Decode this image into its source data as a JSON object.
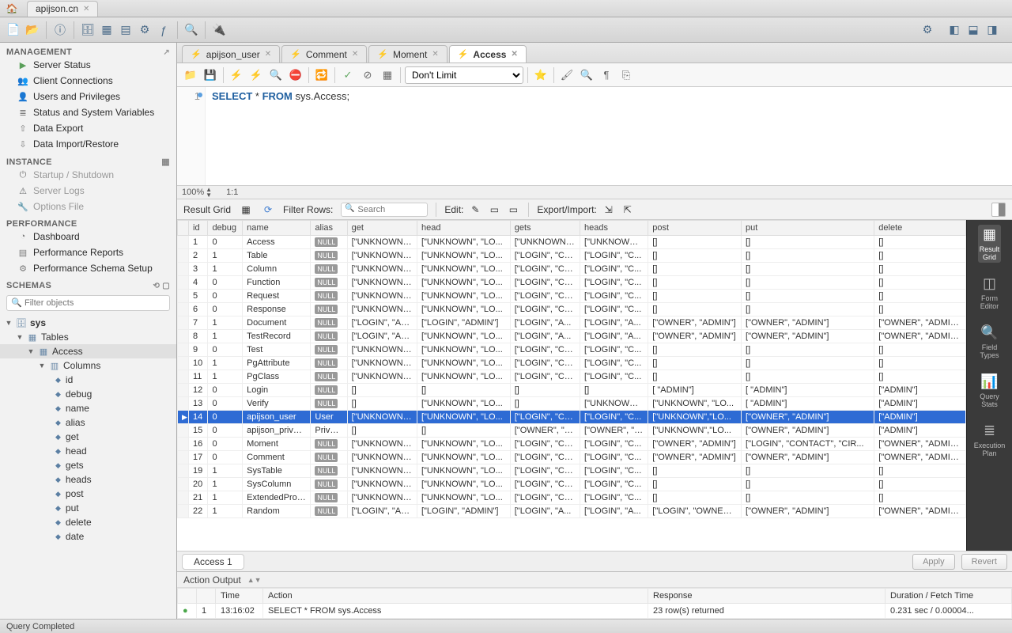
{
  "topTab": {
    "label": "apijson.cn"
  },
  "sidebar": {
    "management": {
      "title": "MANAGEMENT",
      "items": [
        {
          "label": "Server Status",
          "ic": "▶",
          "cls": "play"
        },
        {
          "label": "Client Connections",
          "ic": "👥"
        },
        {
          "label": "Users and Privileges",
          "ic": "👤"
        },
        {
          "label": "Status and System Variables",
          "ic": "≣"
        },
        {
          "label": "Data Export",
          "ic": "⇧"
        },
        {
          "label": "Data Import/Restore",
          "ic": "⇩"
        }
      ]
    },
    "instance": {
      "title": "INSTANCE",
      "items": [
        {
          "label": "Startup / Shutdown",
          "ic": "⏻",
          "dim": true
        },
        {
          "label": "Server Logs",
          "ic": "⚠",
          "cls": "warn",
          "dim": true
        },
        {
          "label": "Options File",
          "ic": "🔧",
          "dim": true
        }
      ]
    },
    "performance": {
      "title": "PERFORMANCE",
      "items": [
        {
          "label": "Dashboard",
          "ic": "◔"
        },
        {
          "label": "Performance Reports",
          "ic": "▤"
        },
        {
          "label": "Performance Schema Setup",
          "ic": "⚙"
        }
      ]
    },
    "schemas": {
      "title": "SCHEMAS",
      "filterPlaceholder": "Filter objects"
    },
    "tree": {
      "db": "sys",
      "tables": "Tables",
      "table": "Access",
      "columns": "Columns",
      "cols": [
        "id",
        "debug",
        "name",
        "alias",
        "get",
        "head",
        "gets",
        "heads",
        "post",
        "put",
        "delete",
        "date"
      ]
    }
  },
  "fileTabs": [
    {
      "label": "apijson_user",
      "active": false
    },
    {
      "label": "Comment",
      "active": false
    },
    {
      "label": "Moment",
      "active": false
    },
    {
      "label": "Access",
      "active": true
    }
  ],
  "sqlLimit": "Don't Limit",
  "query": "SELECT * FROM sys.Access;",
  "queryKw1": "SELECT",
  "queryStar": " * ",
  "queryKw2": "FROM",
  "queryRest": " sys.Access;",
  "zoom": "100%",
  "pos": "1:1",
  "resultBar": {
    "grid": "Result Grid",
    "filter": "Filter Rows:",
    "searchPlaceholder": "Search",
    "edit": "Edit:",
    "export": "Export/Import:"
  },
  "gridColumns": [
    "",
    "id",
    "debug",
    "name",
    "alias",
    "get",
    "head",
    "gets",
    "heads",
    "post",
    "put",
    "delete"
  ],
  "gridRows": [
    {
      "id": "1",
      "debug": "0",
      "name": "Access",
      "alias": null,
      "get": "[\"UNKNOWN\"...",
      "head": "[\"UNKNOWN\", \"LO...",
      "gets": "[\"UNKNOWN\",...",
      "heads": "[\"UNKNOWN\"...",
      "post": "[]",
      "put": "[]",
      "delete": "[]"
    },
    {
      "id": "2",
      "debug": "1",
      "name": "Table",
      "alias": null,
      "get": "[\"UNKNOWN\"...",
      "head": "[\"UNKNOWN\", \"LO...",
      "gets": "[\"LOGIN\", \"CO...",
      "heads": "[\"LOGIN\", \"C...",
      "post": "[]",
      "put": "[]",
      "delete": "[]"
    },
    {
      "id": "3",
      "debug": "1",
      "name": "Column",
      "alias": null,
      "get": "[\"UNKNOWN\"...",
      "head": "[\"UNKNOWN\", \"LO...",
      "gets": "[\"LOGIN\", \"CO...",
      "heads": "[\"LOGIN\", \"C...",
      "post": "[]",
      "put": "[]",
      "delete": "[]"
    },
    {
      "id": "4",
      "debug": "0",
      "name": "Function",
      "alias": null,
      "get": "[\"UNKNOWN\"...",
      "head": "[\"UNKNOWN\", \"LO...",
      "gets": "[\"LOGIN\", \"CO...",
      "heads": "[\"LOGIN\", \"C...",
      "post": "[]",
      "put": "[]",
      "delete": "[]"
    },
    {
      "id": "5",
      "debug": "0",
      "name": "Request",
      "alias": null,
      "get": "[\"UNKNOWN\"...",
      "head": "[\"UNKNOWN\", \"LO...",
      "gets": "[\"LOGIN\", \"CO...",
      "heads": "[\"LOGIN\", \"C...",
      "post": "[]",
      "put": "[]",
      "delete": "[]"
    },
    {
      "id": "6",
      "debug": "0",
      "name": "Response",
      "alias": null,
      "get": "[\"UNKNOWN\"...",
      "head": "[\"UNKNOWN\", \"LO...",
      "gets": "[\"LOGIN\", \"CO...",
      "heads": "[\"LOGIN\", \"C...",
      "post": "[]",
      "put": "[]",
      "delete": "[]"
    },
    {
      "id": "7",
      "debug": "1",
      "name": "Document",
      "alias": null,
      "get": "[\"LOGIN\", \"AD...",
      "head": "[\"LOGIN\", \"ADMIN\"]",
      "gets": "[\"LOGIN\", \"A...",
      "heads": "[\"LOGIN\", \"A...",
      "post": "[\"OWNER\", \"ADMIN\"]",
      "put": "[\"OWNER\", \"ADMIN\"]",
      "delete": "[\"OWNER\", \"ADMIN\"]"
    },
    {
      "id": "8",
      "debug": "1",
      "name": "TestRecord",
      "alias": null,
      "get": "[\"LOGIN\", \"AD...",
      "head": "[\"UNKNOWN\", \"LO...",
      "gets": "[\"LOGIN\", \"A...",
      "heads": "[\"LOGIN\", \"A...",
      "post": "[\"OWNER\", \"ADMIN\"]",
      "put": "[\"OWNER\", \"ADMIN\"]",
      "delete": "[\"OWNER\", \"ADMIN\"]"
    },
    {
      "id": "9",
      "debug": "0",
      "name": "Test",
      "alias": null,
      "get": "[\"UNKNOWN\"...",
      "head": "[\"UNKNOWN\", \"LO...",
      "gets": "[\"LOGIN\", \"CO...",
      "heads": "[\"LOGIN\", \"C...",
      "post": "[]",
      "put": "[]",
      "delete": "[]"
    },
    {
      "id": "10",
      "debug": "1",
      "name": "PgAttribute",
      "alias": null,
      "get": "[\"UNKNOWN\"...",
      "head": "[\"UNKNOWN\", \"LO...",
      "gets": "[\"LOGIN\", \"CO...",
      "heads": "[\"LOGIN\", \"C...",
      "post": "[]",
      "put": "[]",
      "delete": "[]"
    },
    {
      "id": "11",
      "debug": "1",
      "name": "PgClass",
      "alias": null,
      "get": "[\"UNKNOWN\"...",
      "head": "[\"UNKNOWN\", \"LO...",
      "gets": "[\"LOGIN\", \"CO...",
      "heads": "[\"LOGIN\", \"C...",
      "post": "[]",
      "put": "[]",
      "delete": "[]"
    },
    {
      "id": "12",
      "debug": "0",
      "name": "Login",
      "alias": null,
      "get": "[]",
      "head": "[]",
      "gets": "[]",
      "heads": "[]",
      "post": "[ \"ADMIN\"]",
      "put": "[ \"ADMIN\"]",
      "delete": "[\"ADMIN\"]"
    },
    {
      "id": "13",
      "debug": "0",
      "name": "Verify",
      "alias": null,
      "get": "[]",
      "head": "[\"UNKNOWN\", \"LO...",
      "gets": "[]",
      "heads": "[\"UNKNOWN\", \"LO...",
      "post": "[\"UNKNOWN\", \"LO...",
      "put": "[ \"ADMIN\"]",
      "delete": "[\"ADMIN\"]"
    },
    {
      "id": "14",
      "debug": "0",
      "name": "apijson_user",
      "alias": "User",
      "get": "[\"UNKNOWN\"...",
      "head": "[\"UNKNOWN\", \"LO...",
      "gets": "[\"LOGIN\", \"CO...",
      "heads": "[\"LOGIN\", \"C...",
      "post": "[\"UNKNOWN\",\"LO...",
      "put": "[\"OWNER\", \"ADMIN\"]",
      "delete": "[\"ADMIN\"]",
      "sel": true
    },
    {
      "id": "15",
      "debug": "0",
      "name": "apijson_privacy",
      "alias": "Privacy",
      "get": "[]",
      "head": "[]",
      "gets": "[\"OWNER\", \"A...",
      "heads": "[\"OWNER\", \"A...",
      "post": "[\"UNKNOWN\",\"LO...",
      "put": "[\"OWNER\", \"ADMIN\"]",
      "delete": "[\"ADMIN\"]"
    },
    {
      "id": "16",
      "debug": "0",
      "name": "Moment",
      "alias": null,
      "get": "[\"UNKNOWN\"...",
      "head": "[\"UNKNOWN\", \"LO...",
      "gets": "[\"LOGIN\", \"CO...",
      "heads": "[\"LOGIN\", \"C...",
      "post": "[\"OWNER\", \"ADMIN\"]",
      "put": "[\"LOGIN\", \"CONTACT\", \"CIR...",
      "delete": "[\"OWNER\", \"ADMIN\"]"
    },
    {
      "id": "17",
      "debug": "0",
      "name": "Comment",
      "alias": null,
      "get": "[\"UNKNOWN\"...",
      "head": "[\"UNKNOWN\", \"LO...",
      "gets": "[\"LOGIN\", \"CO...",
      "heads": "[\"LOGIN\", \"C...",
      "post": "[\"OWNER\", \"ADMIN\"]",
      "put": "[\"OWNER\", \"ADMIN\"]",
      "delete": "[\"OWNER\", \"ADMIN\"]"
    },
    {
      "id": "19",
      "debug": "1",
      "name": "SysTable",
      "alias": null,
      "get": "[\"UNKNOWN\"...",
      "head": "[\"UNKNOWN\", \"LO...",
      "gets": "[\"LOGIN\", \"CO...",
      "heads": "[\"LOGIN\", \"C...",
      "post": "[]",
      "put": "[]",
      "delete": "[]"
    },
    {
      "id": "20",
      "debug": "1",
      "name": "SysColumn",
      "alias": null,
      "get": "[\"UNKNOWN\"...",
      "head": "[\"UNKNOWN\", \"LO...",
      "gets": "[\"LOGIN\", \"CO...",
      "heads": "[\"LOGIN\", \"C...",
      "post": "[]",
      "put": "[]",
      "delete": "[]"
    },
    {
      "id": "21",
      "debug": "1",
      "name": "ExtendedProp...",
      "alias": null,
      "get": "[\"UNKNOWN\"...",
      "head": "[\"UNKNOWN\", \"LO...",
      "gets": "[\"LOGIN\", \"CO...",
      "heads": "[\"LOGIN\", \"C...",
      "post": "[]",
      "put": "[]",
      "delete": "[]"
    },
    {
      "id": "22",
      "debug": "1",
      "name": "Random",
      "alias": null,
      "get": "[\"LOGIN\", \"AD...",
      "head": "[\"LOGIN\", \"ADMIN\"]",
      "gets": "[\"LOGIN\", \"A...",
      "heads": "[\"LOGIN\", \"A...",
      "post": "[\"LOGIN\", \"OWNER\", \"ADMIN\"]",
      "put": "[\"OWNER\", \"ADMIN\"]",
      "delete": "[\"OWNER\", \"ADMIN\"]"
    }
  ],
  "gridRight": [
    {
      "label": "Result\nGrid",
      "ic": "▦",
      "active": true
    },
    {
      "label": "Form\nEditor",
      "ic": "◫"
    },
    {
      "label": "Field\nTypes",
      "ic": "🔍"
    },
    {
      "label": "Query\nStats",
      "ic": "📊"
    },
    {
      "label": "Execution\nPlan",
      "ic": "≣"
    }
  ],
  "gridTab": "Access 1",
  "applyBtn": "Apply",
  "revertBtn": "Revert",
  "actionOutput": {
    "title": "Action Output",
    "cols": [
      "",
      "",
      "Time",
      "Action",
      "Response",
      "Duration / Fetch Time"
    ],
    "row": {
      "n": "1",
      "time": "13:16:02",
      "action": "SELECT * FROM sys.Access",
      "response": "23 row(s) returned",
      "duration": "0.231 sec / 0.00004..."
    }
  },
  "status": "Query Completed"
}
